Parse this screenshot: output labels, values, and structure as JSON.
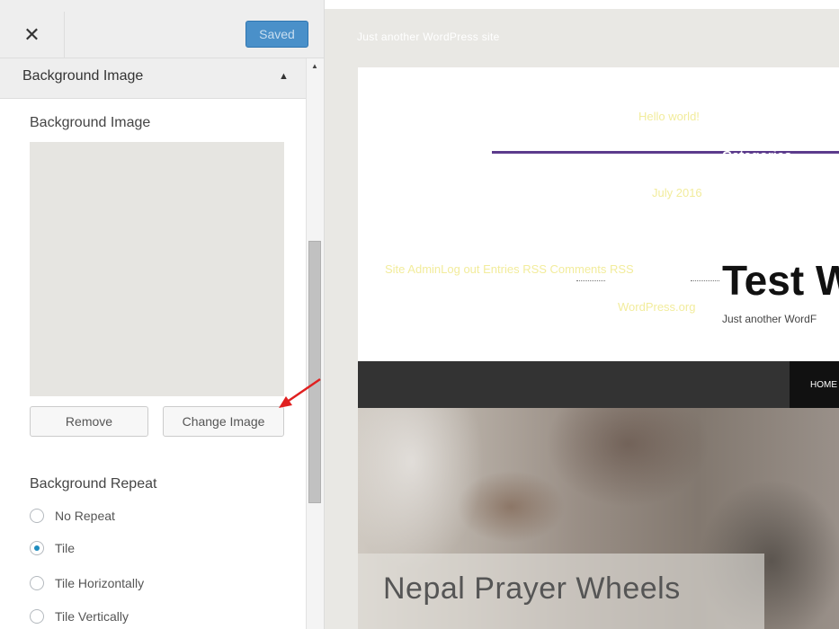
{
  "sidebar": {
    "close_glyph": "✕",
    "saved_label": "Saved",
    "section_title": "Background Image",
    "section_arrow": "▲",
    "scroll_up_glyph": "▲",
    "control_title": "Background Image",
    "remove_label": "Remove",
    "change_image_label": "Change Image",
    "repeat_title": "Background Repeat",
    "repeat_options": [
      {
        "label": "No Repeat",
        "checked": false
      },
      {
        "label": "Tile",
        "checked": true
      },
      {
        "label": "Tile Horizontally",
        "checked": false
      },
      {
        "label": "Tile Vertically",
        "checked": false
      }
    ]
  },
  "preview": {
    "tagline_top": "Just another WordPress site",
    "hello_world": "Hello world!",
    "categories": "Categories",
    "archive_month": "July 2016",
    "meta_links": "Site AdminLog out Entries RSS Comments RSS",
    "wordpress_org": "WordPress.org",
    "site_title": "Test W",
    "site_description": "Just another WordF",
    "nav_home": "HOME",
    "hero_title": "Nepal Prayer Wheels"
  },
  "colors": {
    "accent_button": "#4a90c9",
    "radio_checked": "#1e8cbe",
    "annotation_arrow": "#e02020",
    "widget_link": "#f2ec9c",
    "menu_bar": "#333333"
  }
}
